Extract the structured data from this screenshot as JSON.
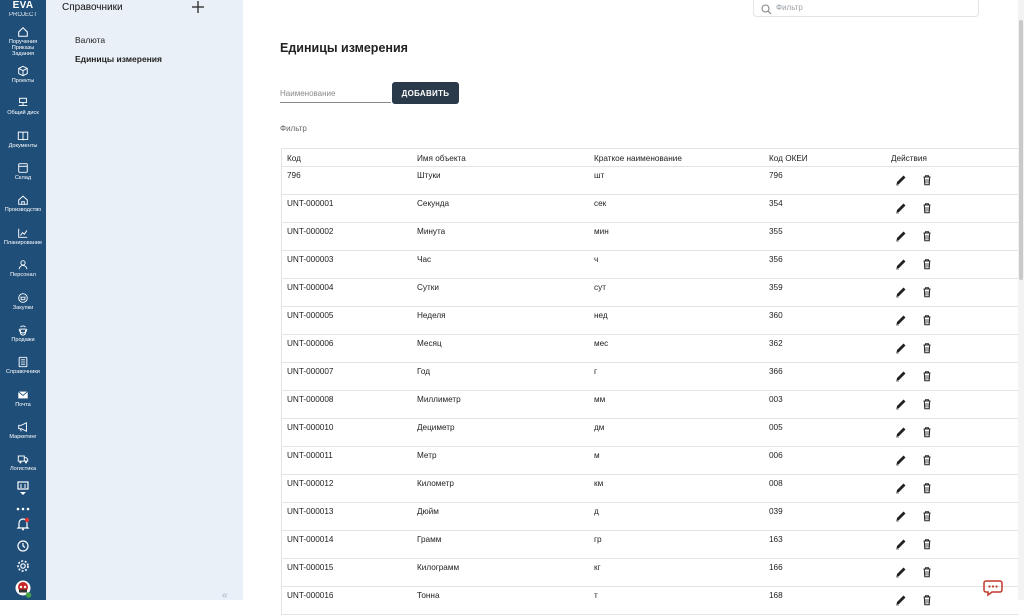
{
  "brand": {
    "name": "EVA",
    "sub": "PROJECT"
  },
  "nav": [
    {
      "label": "Поручения\nПриказы\nЗадания",
      "icon": "home-icon"
    },
    {
      "label": "Проекты",
      "icon": "box-icon"
    },
    {
      "label": "Общий диск",
      "icon": "network-drive-icon"
    },
    {
      "label": "Документы",
      "icon": "book-icon"
    },
    {
      "label": "Склад",
      "icon": "warehouse-icon"
    },
    {
      "label": "Производство",
      "icon": "factory-icon"
    },
    {
      "label": "Планирование",
      "icon": "chart-icon"
    },
    {
      "label": "Персонал",
      "icon": "person-icon"
    },
    {
      "label": "Закупки",
      "icon": "cart-icon"
    },
    {
      "label": "Продажи",
      "icon": "sales-icon"
    },
    {
      "label": "Справочники",
      "icon": "directory-icon"
    },
    {
      "label": "Почта",
      "icon": "mail-icon"
    },
    {
      "label": "Маркетинг",
      "icon": "megaphone-icon"
    },
    {
      "label": "Логистика",
      "icon": "truck-icon"
    }
  ],
  "panel": {
    "title": "Справочники",
    "items": [
      {
        "label": "Валюта",
        "active": false
      },
      {
        "label": "Единицы измерения",
        "active": true
      }
    ]
  },
  "search": {
    "placeholder": "Фильтр"
  },
  "page": {
    "title": "Единицы измерения",
    "name_placeholder": "Наименование",
    "add_label": "ДОБАВИТЬ",
    "filter_label": "Фильтр"
  },
  "table": {
    "columns": [
      "Код",
      "Имя объекта",
      "Краткое наименование",
      "Код ОКЕИ",
      "Действия"
    ],
    "rows": [
      [
        "796",
        "Штуки",
        "шт",
        "796"
      ],
      [
        "UNT-000001",
        "Секунда",
        "сек",
        "354"
      ],
      [
        "UNT-000002",
        "Минута",
        "мин",
        "355"
      ],
      [
        "UNT-000003",
        "Час",
        "ч",
        "356"
      ],
      [
        "UNT-000004",
        "Сутки",
        "сут",
        "359"
      ],
      [
        "UNT-000005",
        "Неделя",
        "нед",
        "360"
      ],
      [
        "UNT-000006",
        "Месяц",
        "мес",
        "362"
      ],
      [
        "UNT-000007",
        "Год",
        "г",
        "366"
      ],
      [
        "UNT-000008",
        "Миллиметр",
        "мм",
        "003"
      ],
      [
        "UNT-000010",
        "Дециметр",
        "дм",
        "005"
      ],
      [
        "UNT-000011",
        "Метр",
        "м",
        "006"
      ],
      [
        "UNT-000012",
        "Километр",
        "км",
        "008"
      ],
      [
        "UNT-000013",
        "Дюйм",
        "д",
        "039"
      ],
      [
        "UNT-000014",
        "Грамм",
        "гр",
        "163"
      ],
      [
        "UNT-000015",
        "Килограмм",
        "кг",
        "166"
      ],
      [
        "UNT-000016",
        "Тонна",
        "т",
        "168"
      ]
    ]
  },
  "colors": {
    "rail": "#1f4e79",
    "panel": "#e9f0f8",
    "button": "#2b3a4a",
    "notification": "#e53935",
    "online": "#43a047"
  }
}
